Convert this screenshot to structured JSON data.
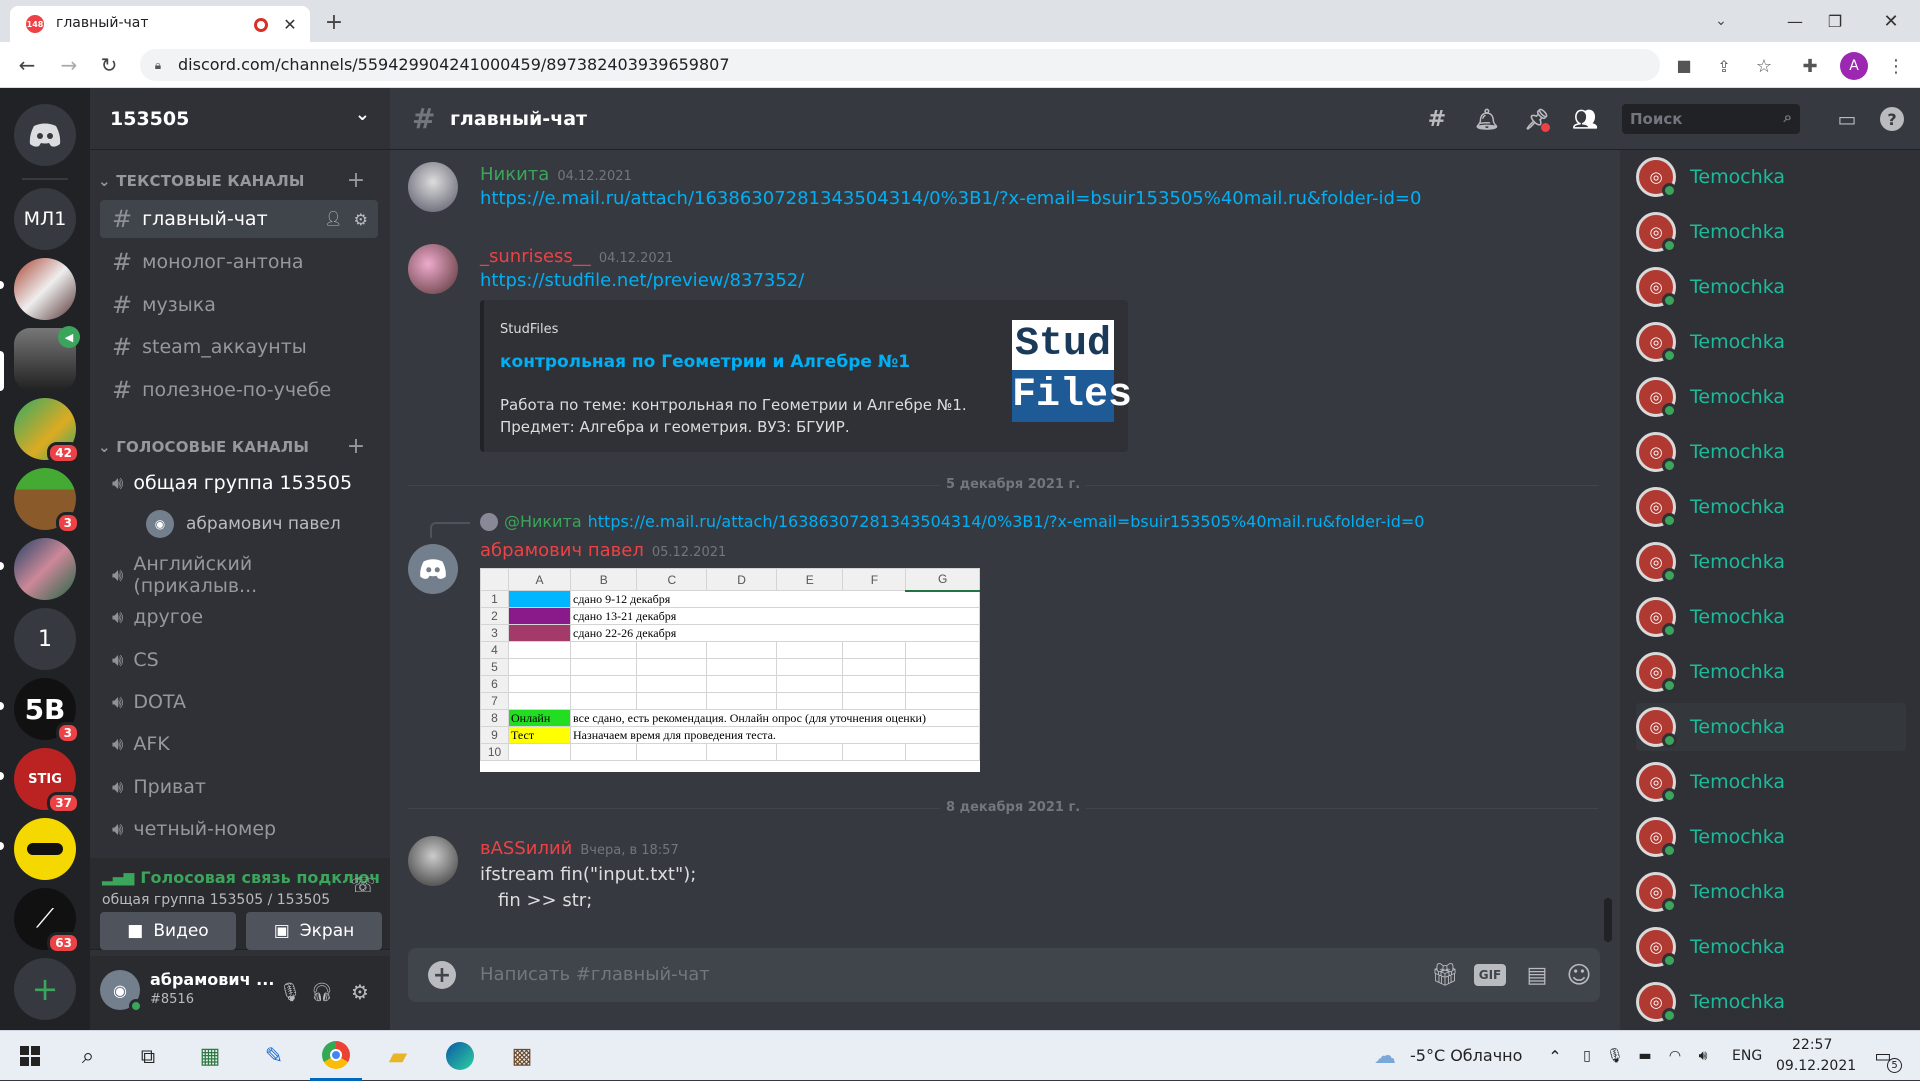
{
  "browser": {
    "tab_title": "главный-чат",
    "tab_badge": "148",
    "url": "discord.com/channels/559429904241000459/897382403939659807",
    "profile_letter": "A"
  },
  "servers": [
    {
      "label": "МЛ1"
    },
    {
      "label": ""
    },
    {
      "label": "",
      "badge": ""
    },
    {
      "label": "",
      "badge": "42"
    },
    {
      "label": "",
      "badge": "3"
    },
    {
      "label": ""
    },
    {
      "label": "1"
    },
    {
      "label": "5B",
      "badge": "3"
    },
    {
      "label": "STIG",
      "badge": "37"
    },
    {
      "label": ""
    },
    {
      "label": "",
      "badge": "63"
    }
  ],
  "sidebar": {
    "server_name": "153505",
    "text_category": "ТЕКСТОВЫЕ КАНАЛЫ",
    "text_channels": [
      "главный-чат",
      "монолог-антона",
      "музыка",
      "steam_аккаунты",
      "полезное-по-учебе"
    ],
    "voice_category": "ГОЛОСОВЫЕ КАНАЛЫ",
    "voice_channels": [
      "общая группа 153505",
      "Английский (прикалыв...",
      "другое",
      "CS",
      "DOTA",
      "AFK",
      "Приват",
      "четный-номер"
    ],
    "voice_member": "абрамович павел"
  },
  "voice_panel": {
    "status": "Голосовая связь подключ",
    "channel": "общая группа 153505 / 153505",
    "video_label": "Видео",
    "screen_label": "Экран"
  },
  "user_panel": {
    "name": "абрамович ...",
    "tag": "#8516"
  },
  "channel": {
    "name": "главный-чат",
    "search_placeholder": "Поиск",
    "input_placeholder": "Написать #главный-чат",
    "gif_label": "GIF"
  },
  "messages": [
    {
      "author": "Никита",
      "time": "04.12.2021",
      "text": "https://e.mail.ru/attach/16386307281343504314/0%3B1/?x-email=bsuir153505%40mail.ru&folder-id=0"
    },
    {
      "author": "_sunrisess__",
      "time": "04.12.2021",
      "text": "https://studfile.net/preview/837352/",
      "embed": {
        "provider": "StudFiles",
        "title": "контрольная по Геометрии и Алгебре №1",
        "desc1": "Работа по теме: контрольная по Геометрии и Алгебре №1.",
        "desc2": "Предмет: Алгебра и геометрия. ВУЗ: БГУИР.",
        "thumb_line1": "Stud",
        "thumb_line2": "Files"
      }
    },
    {
      "author": "абрамович павел",
      "time": "05.12.2021",
      "reply_to": "@Никита",
      "reply_text": "https://e.mail.ru/attach/16386307281343504314/0%3B1/?x-email=bsuir153505%40mail.ru&folder-id=0"
    },
    {
      "author": "вASSилий",
      "time": "Вчера, в 18:57",
      "line1": "ifstream fin(\"input.txt\");",
      "line2": "fin >> str;"
    }
  ],
  "dividers": [
    "5 декабря 2021 г.",
    "8 декабря 2021 г."
  ],
  "sheet": {
    "cols": [
      "A",
      "B",
      "C",
      "D",
      "E",
      "F",
      "G"
    ],
    "rows": [
      "1",
      "2",
      "3",
      "4",
      "5",
      "6",
      "7",
      "8",
      "9",
      "10"
    ],
    "r1": "сдано 9-12 декабря",
    "r2": "сдано 13-21 декабря",
    "r3": "сдано 22-26 декабря",
    "r8a": "Онлайн",
    "r8b": "все сдано, есть рекомендация. Онлайн опрос (для уточнения оценки)",
    "r9a": "Тест",
    "r9b": "Назначаем время для проведения теста."
  },
  "members": [
    "Temochka",
    "Temochka",
    "Temochka",
    "Temochka",
    "Temochka",
    "Temochka",
    "Temochka",
    "Temochka",
    "Temochka",
    "Temochka",
    "Temochka",
    "Temochka",
    "Temochka",
    "Temochka",
    "Temochka",
    "Temochka"
  ],
  "taskbar": {
    "weather": "-5°C  Облачно",
    "lang": "ENG",
    "time": "22:57",
    "date": "09.12.2021",
    "notif": "5"
  },
  "colors": {
    "brand": "#5865f2",
    "link": "#00aff4",
    "online": "#3ba55c",
    "danger": "#ed4245"
  }
}
